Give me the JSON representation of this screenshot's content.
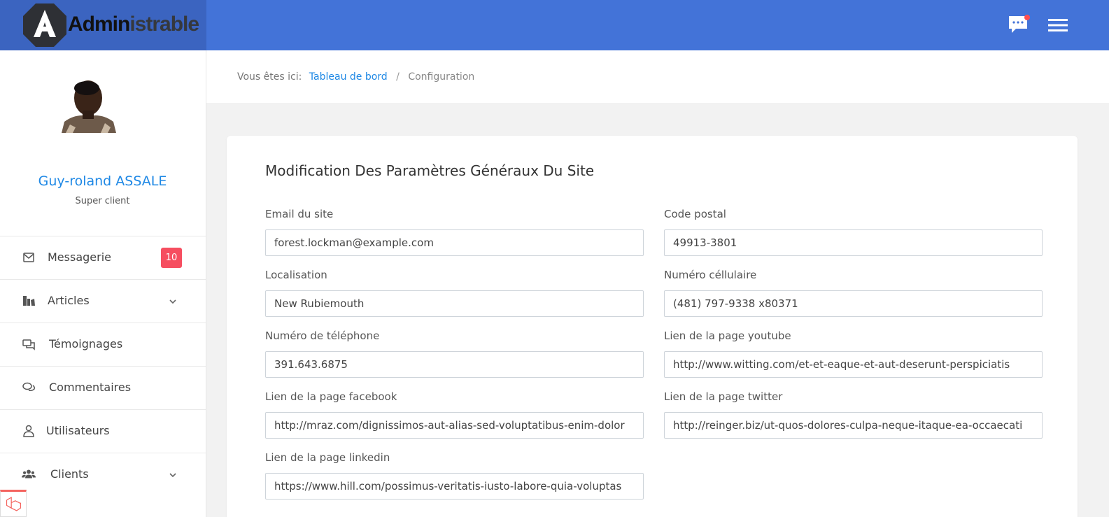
{
  "logo": {
    "part1": "Admin",
    "part2": "istrable"
  },
  "header": {
    "chat_icon": "chat-icon",
    "menu_icon": "hamburger-menu-icon"
  },
  "user": {
    "name": "Guy-roland ASSALE",
    "role": "Super client"
  },
  "sidebar": {
    "items": [
      {
        "label": "Messagerie",
        "icon": "envelope-icon",
        "badge": "10"
      },
      {
        "label": "Articles",
        "icon": "articles-icon",
        "chevron": true
      },
      {
        "label": "Témoignages",
        "icon": "testimonial-icon"
      },
      {
        "label": "Commentaires",
        "icon": "comments-icon"
      },
      {
        "label": "Utilisateurs",
        "icon": "user-icon"
      },
      {
        "label": "Clients",
        "icon": "users-icon",
        "chevron": true
      }
    ]
  },
  "breadcrumb": {
    "prefix": "Vous êtes ici:",
    "home": "Tableau de bord",
    "current": "Configuration"
  },
  "form": {
    "title": "Modification Des Paramètres Généraux Du Site",
    "fields": {
      "email": {
        "label": "Email du site",
        "value": "forest.lockman@example.com"
      },
      "postal": {
        "label": "Code postal",
        "value": "49913-3801"
      },
      "location": {
        "label": "Localisation",
        "value": "New Rubiemouth"
      },
      "mobile": {
        "label": "Numéro céllulaire",
        "value": "(481) 797-9338 x80371"
      },
      "phone": {
        "label": "Numéro de téléphone",
        "value": "391.643.6875"
      },
      "youtube": {
        "label": "Lien de la page youtube",
        "value": "http://www.witting.com/et-et-eaque-et-aut-deserunt-perspiciatis"
      },
      "facebook": {
        "label": "Lien de la page facebook",
        "value": "http://mraz.com/dignissimos-aut-alias-sed-voluptatibus-enim-dolor"
      },
      "twitter": {
        "label": "Lien de la page twitter",
        "value": "http://reinger.biz/ut-quos-dolores-culpa-neque-itaque-ea-occaecati"
      },
      "linkedin": {
        "label": "Lien de la page linkedin",
        "value": "https://www.hill.com/possimus-veritatis-iusto-labore-quia-voluptas"
      }
    }
  },
  "colors": {
    "topbar": "#4373d8",
    "brand": "#3b64c0",
    "accent": "#1e88e5",
    "badge": "#f64e60"
  }
}
